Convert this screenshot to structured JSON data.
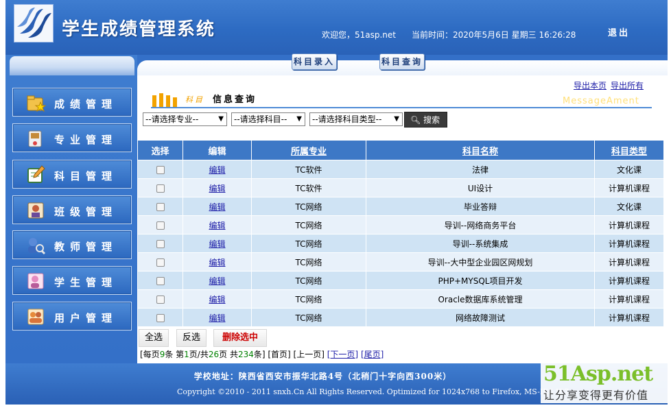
{
  "header": {
    "app_title": "学生成绩管理系统",
    "welcome": "欢迎您，51asp.net",
    "datetime": "当前时间：2020年5月6日 星期三 16:26:28",
    "logout": "退出"
  },
  "sidebar": {
    "items": [
      {
        "label": "成绩管理",
        "icon": "star-folder-icon"
      },
      {
        "label": "专业管理",
        "icon": "book-icon"
      },
      {
        "label": "科目管理",
        "icon": "edit-pad-icon"
      },
      {
        "label": "班级管理",
        "icon": "classroom-icon"
      },
      {
        "label": "教师管理",
        "icon": "user-search-icon"
      },
      {
        "label": "学生管理",
        "icon": "student-icon"
      },
      {
        "label": "用户管理",
        "icon": "users-icon"
      }
    ]
  },
  "toolbar": {
    "subject_entry": "科目录入",
    "subject_query": "科目查询"
  },
  "export": {
    "page": "导出本页",
    "all": "导出所有"
  },
  "section": {
    "sub": "科目",
    "title": "信息查询",
    "english": "MessageAment"
  },
  "filters": {
    "major": "--请选择专业--",
    "subject": "--请选择科目--",
    "subject_type": "--请选择科目类型--",
    "search": "搜索"
  },
  "table": {
    "headers": [
      "选择",
      "编辑",
      "所属专业",
      "科目名称",
      "科目类型"
    ],
    "rows": [
      {
        "edit": "编辑",
        "major": "TC软件",
        "name": "法律",
        "type": "文化课"
      },
      {
        "edit": "编辑",
        "major": "TC软件",
        "name": "UI设计",
        "type": "计算机课程"
      },
      {
        "edit": "编辑",
        "major": "TC网络",
        "name": "毕业答辩",
        "type": "文化课"
      },
      {
        "edit": "编辑",
        "major": "TC网络",
        "name": "导训--网络商务平台",
        "type": "计算机课程"
      },
      {
        "edit": "编辑",
        "major": "TC网络",
        "name": "导训--系统集成",
        "type": "计算机课程"
      },
      {
        "edit": "编辑",
        "major": "TC网络",
        "name": "导训--大中型企业园区网规划",
        "type": "计算机课程"
      },
      {
        "edit": "编辑",
        "major": "TC网络",
        "name": "PHP+MYSQL项目开发",
        "type": "计算机课程"
      },
      {
        "edit": "编辑",
        "major": "TC网络",
        "name": "Oracle数据库系统管理",
        "type": "计算机课程"
      },
      {
        "edit": "编辑",
        "major": "TC网络",
        "name": "网络故障测试",
        "type": "计算机课程"
      }
    ]
  },
  "actions": {
    "select_all": "全选",
    "invert": "反选",
    "delete_selected": "删除选中"
  },
  "pager": {
    "p1": "[每页",
    "per_page": "9",
    "p2": "条 第",
    "current": "1",
    "p3": "页/共",
    "total_pages": "26",
    "p4": "页 共",
    "total_records": "234",
    "p5": "条] [首页] [上一页]",
    "next": "[下一页]",
    "last": "[尾页]"
  },
  "footer": {
    "address": "学校地址：陕西省西安市振华北路4号（北稍门十字向西300米）",
    "copyright": "Copyright ©2010 - 2011 snxh.Cn All Rights Reserved. Optimized for 1024x768 to Firefox, MS-IE6 IE7"
  },
  "watermark": {
    "logo": "51Asp.net",
    "slogan": "让分享变得更有价值"
  },
  "colors": {
    "header_blue": "#2d6bc2",
    "table_header": "#3d78c6",
    "row_even": "#cfe3f4",
    "row_odd": "#e8f1fa",
    "delete_red": "#cc0000",
    "watermark_green": "#7bbf2a"
  }
}
